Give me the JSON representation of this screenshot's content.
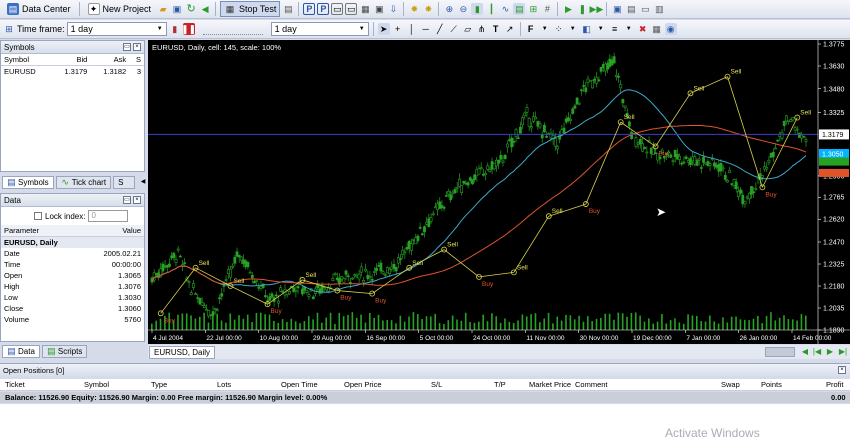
{
  "toolbar1": {
    "data_center": "Data Center",
    "new_project": "New Project",
    "stop_test": "Stop Test"
  },
  "toolbar2": {
    "timeframe_label": "Time frame:",
    "timeframe_value": "1 day",
    "timeframe2_value": "1 day"
  },
  "symbols_panel": {
    "title": "Symbols",
    "columns": [
      "Symbol",
      "Bid",
      "Ask",
      "S"
    ],
    "rows": [
      [
        "EURUSD",
        "1.3179",
        "1.3182",
        "3"
      ]
    ],
    "tabs": [
      "Symbols",
      "Tick chart",
      "S"
    ]
  },
  "data_panel": {
    "title": "Data",
    "lock_index_label": "Lock index:",
    "lock_index_value": "0",
    "col_param": "Parameter",
    "col_value": "Value",
    "section": "EURUSD, Daily",
    "rows": [
      [
        "Date",
        "2005.02.21"
      ],
      [
        "Time",
        "00:00:00"
      ],
      [
        "Open",
        "1.3065"
      ],
      [
        "High",
        "1.3076"
      ],
      [
        "Low",
        "1.3030"
      ],
      [
        "Close",
        "1.3060"
      ],
      [
        "Volume",
        "5760"
      ]
    ],
    "tabs": [
      "Data",
      "Scripts"
    ]
  },
  "chart": {
    "header": "EURUSD, Daily, cell: 145, scale: 100%",
    "tab": "EURUSD, Daily",
    "price_labels": [
      "1.3775",
      "1.3630",
      "1.3480",
      "1.3325",
      "1.3179",
      "1.3050",
      "1.2906",
      "1.2765",
      "1.2620",
      "1.2470",
      "1.2325",
      "1.2180",
      "1.2035",
      "1.1890"
    ],
    "date_labels": [
      "4 Jul 2004",
      "22 Jul 00:00",
      "10 Aug 00:00",
      "29 Aug 00:00",
      "16 Sep 00:00",
      "5 Oct 00:00",
      "24 Oct 00:00",
      "11 Nov 00:00",
      "30 Nov 00:00",
      "19 Dec 00:00",
      "7 Jan 00:00",
      "26 Jan 00:00",
      "14 Feb 00:00"
    ],
    "current_price": "1.3179",
    "line2_price": "1.3050",
    "signals": [
      {
        "label": "Buy",
        "price": 1.2
      },
      {
        "label": "Sell",
        "price": 1.23
      },
      {
        "label": "Sell",
        "price": 1.218
      },
      {
        "label": "Buy",
        "price": 1.206
      },
      {
        "label": "Sell",
        "price": 1.222
      },
      {
        "label": "Buy",
        "price": 1.215
      },
      {
        "label": "Buy",
        "price": 1.213
      },
      {
        "label": "Sell",
        "price": 1.23
      },
      {
        "label": "Sell",
        "price": 1.242
      },
      {
        "label": "Buy",
        "price": 1.224
      },
      {
        "label": "Sell",
        "price": 1.227
      },
      {
        "label": "Sell",
        "price": 1.264
      },
      {
        "label": "Buy",
        "price": 1.272
      },
      {
        "label": "Sell",
        "price": 1.326
      },
      {
        "label": "Buy",
        "price": 1.31
      },
      {
        "label": "Sell",
        "price": 1.345
      },
      {
        "label": "Sell",
        "price": 1.356
      },
      {
        "label": "Buy",
        "price": 1.283
      },
      {
        "label": "Sell",
        "price": 1.329
      }
    ]
  },
  "positions": {
    "title": "Open Positions [0]",
    "columns": [
      "Ticket",
      "Symbol",
      "Type",
      "Lots",
      "Open Time",
      "Open Price",
      "S/L",
      "T/P",
      "Market Price",
      "Comment",
      "Swap",
      "Points",
      "Profit"
    ],
    "balance_line": "Balance: 11526.90 Equity: 11526.90 Margin: 0.00 Free margin: 11526.90 Margin level: 0.00%",
    "profit_total": "0.00"
  },
  "watermark": "Activate Windows",
  "colors": {
    "chart_bg": "#000000",
    "candle": "#27a324",
    "ma_fast": "#3fa9c9",
    "ma_slow": "#e0542a",
    "zigzag": "#d9d24a",
    "current_line": "#3a3fc8"
  }
}
